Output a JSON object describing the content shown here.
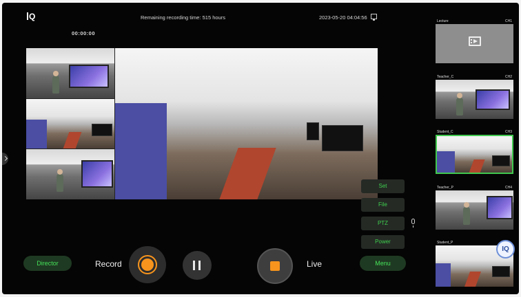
{
  "header": {
    "remaining": "Remaining recording time: 515 hours",
    "datetime": "2023-05-20 04:04:56",
    "recording_timer": "00:00:00"
  },
  "side_menu": {
    "set": "Set",
    "file": "File",
    "ptz": "PTZ",
    "power": "Power"
  },
  "controls": {
    "director": "Director",
    "record": "Record",
    "live": "Live",
    "menu": "Menu"
  },
  "channels": [
    {
      "name": "Lecture",
      "ch": "CH1"
    },
    {
      "name": "Teacher_C",
      "ch": "CH2"
    },
    {
      "name": "Student_C",
      "ch": "CH3",
      "selected": true
    },
    {
      "name": "Teacher_P",
      "ch": "CH4"
    },
    {
      "name": "Student_P",
      "ch": ""
    }
  ],
  "colors": {
    "accent_green": "#3fd04e",
    "accent_orange": "#f7941d",
    "selected_border": "#41c94f"
  }
}
